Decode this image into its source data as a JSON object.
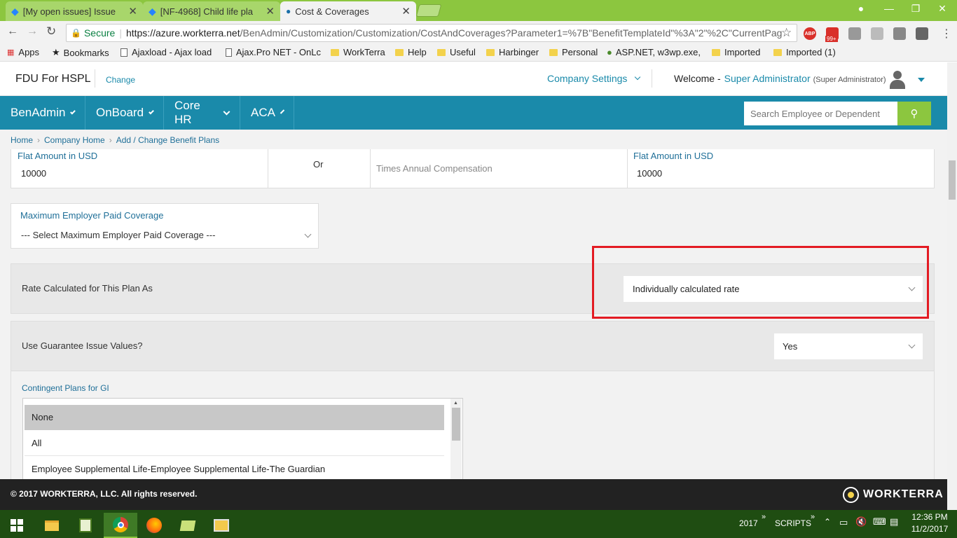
{
  "browser": {
    "tabs": [
      {
        "title": "[My open issues] Issue",
        "active": false
      },
      {
        "title": "[NF-4968] Child life pla",
        "active": false
      },
      {
        "title": "Cost & Coverages",
        "active": true
      }
    ],
    "secure_label": "Secure",
    "url_host": "https://azure.workterra.net",
    "url_path": "/BenAdmin/Customization/Customization/CostAndCoverages?Parameter1=%7B\"BenefitTemplateId\"%3A\"2\"%2C\"CurrentPag",
    "ext_badge": "99+",
    "bookmarks": [
      "Apps",
      "Bookmarks",
      "Ajaxload - Ajax load",
      "Ajax.Pro NET - OnLc",
      "WorkTerra",
      "Help",
      "Useful",
      "Harbinger",
      "Personal",
      "ASP.NET, w3wp.exe,",
      "Imported",
      "Imported (1)"
    ]
  },
  "header": {
    "company": "FDU For HSPL",
    "change_link": "Change",
    "company_settings": "Company Settings",
    "welcome": "Welcome -",
    "user_name": "Super Administrator",
    "user_role": "(Super Administrator)"
  },
  "nav": {
    "items": [
      "BenAdmin",
      "OnBoard",
      "Core HR",
      "ACA"
    ],
    "search_placeholder": "Search Employee or Dependent"
  },
  "breadcrumb": [
    "Home",
    "Company Home",
    "Add / Change Benefit Plans"
  ],
  "form": {
    "flat_amount_label_1": "Flat Amount in USD",
    "flat_amount_value_1": "10000",
    "or_label": "Or",
    "times_annual_comp": "Times Annual Compensation",
    "flat_amount_label_2": "Flat Amount in USD",
    "flat_amount_value_2": "10000",
    "max_employer_label": "Maximum Employer Paid Coverage",
    "max_employer_value": "--- Select Maximum Employer Paid Coverage ---",
    "rate_label": "Rate Calculated for This Plan As",
    "rate_value": "Individually calculated rate",
    "gi_label": "Use Guarantee Issue Values?",
    "gi_value": "Yes",
    "contingent_label": "Contingent Plans for GI",
    "contingent_options": [
      "None",
      "All",
      "Employee Supplemental Life-Employee Supplemental Life-The Guardian"
    ],
    "highlight_color": "#e31b23"
  },
  "footer": {
    "copyright": "© 2017 WORKTERRA, LLC. All rights reserved.",
    "logo": "WORKTERRA"
  },
  "taskbar": {
    "label_year": "2017",
    "label_scripts": "SCRIPTS",
    "time": "12:36 PM",
    "date": "11/2/2017"
  }
}
